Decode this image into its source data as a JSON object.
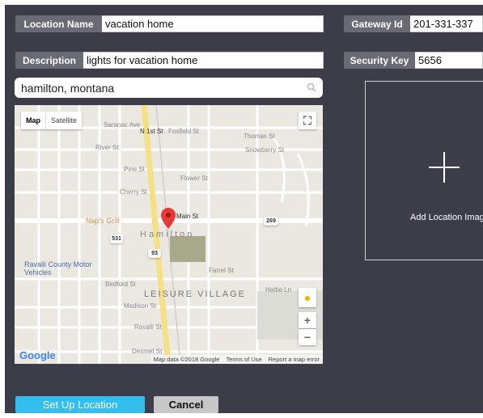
{
  "form": {
    "location_name": {
      "label": "Location Name",
      "value": "vacation home"
    },
    "description": {
      "label": "Description",
      "value": "lights for vacation home"
    },
    "gateway_id": {
      "label": "Gateway Id",
      "value": "201-331-337"
    },
    "security_key": {
      "label": "Security Key",
      "value": "5656"
    }
  },
  "search": {
    "value": "hamilton, montana",
    "icon": "search-icon"
  },
  "map": {
    "map_tab": "Map",
    "satellite_tab": "Satellite",
    "town_label": "Hamilton",
    "area_label": "LEISURE VILLAGE",
    "poi": "Nap's Grill",
    "poi2": "Ravalli County Motor Vehicles",
    "streets": {
      "main": "Main St",
      "first": "N 1st St",
      "saranac": "Saranac Ave",
      "foxfield": "Foxfield St",
      "thomas": "Thomas St",
      "river": "River St",
      "snowberry": "Snowberry St",
      "pine": "Pine St",
      "flower": "Flower St",
      "cherry": "Cherry St",
      "farrel": "Farrel St",
      "bedford": "Bedford St",
      "madison": "Madison St",
      "ravalli": "Ravalli St",
      "desmet": "Desmet St",
      "hattie": "Hattie Ln"
    },
    "route_shields": [
      "269",
      "93",
      "531"
    ],
    "attribution": {
      "data": "Map data ©2018 Google",
      "terms": "Terms of Use",
      "report": "Report a map error"
    },
    "google_logo": "Google"
  },
  "image_upload": {
    "label": "Add Location Imag",
    "icon": "plus-icon"
  },
  "buttons": {
    "setup": "Set Up Location",
    "cancel": "Cancel"
  },
  "colors": {
    "panel": "#3d3d4a",
    "label_bg": "#6a6a74",
    "primary": "#33bfee",
    "cancel": "#c7c7c7",
    "pin": "#e53935"
  }
}
